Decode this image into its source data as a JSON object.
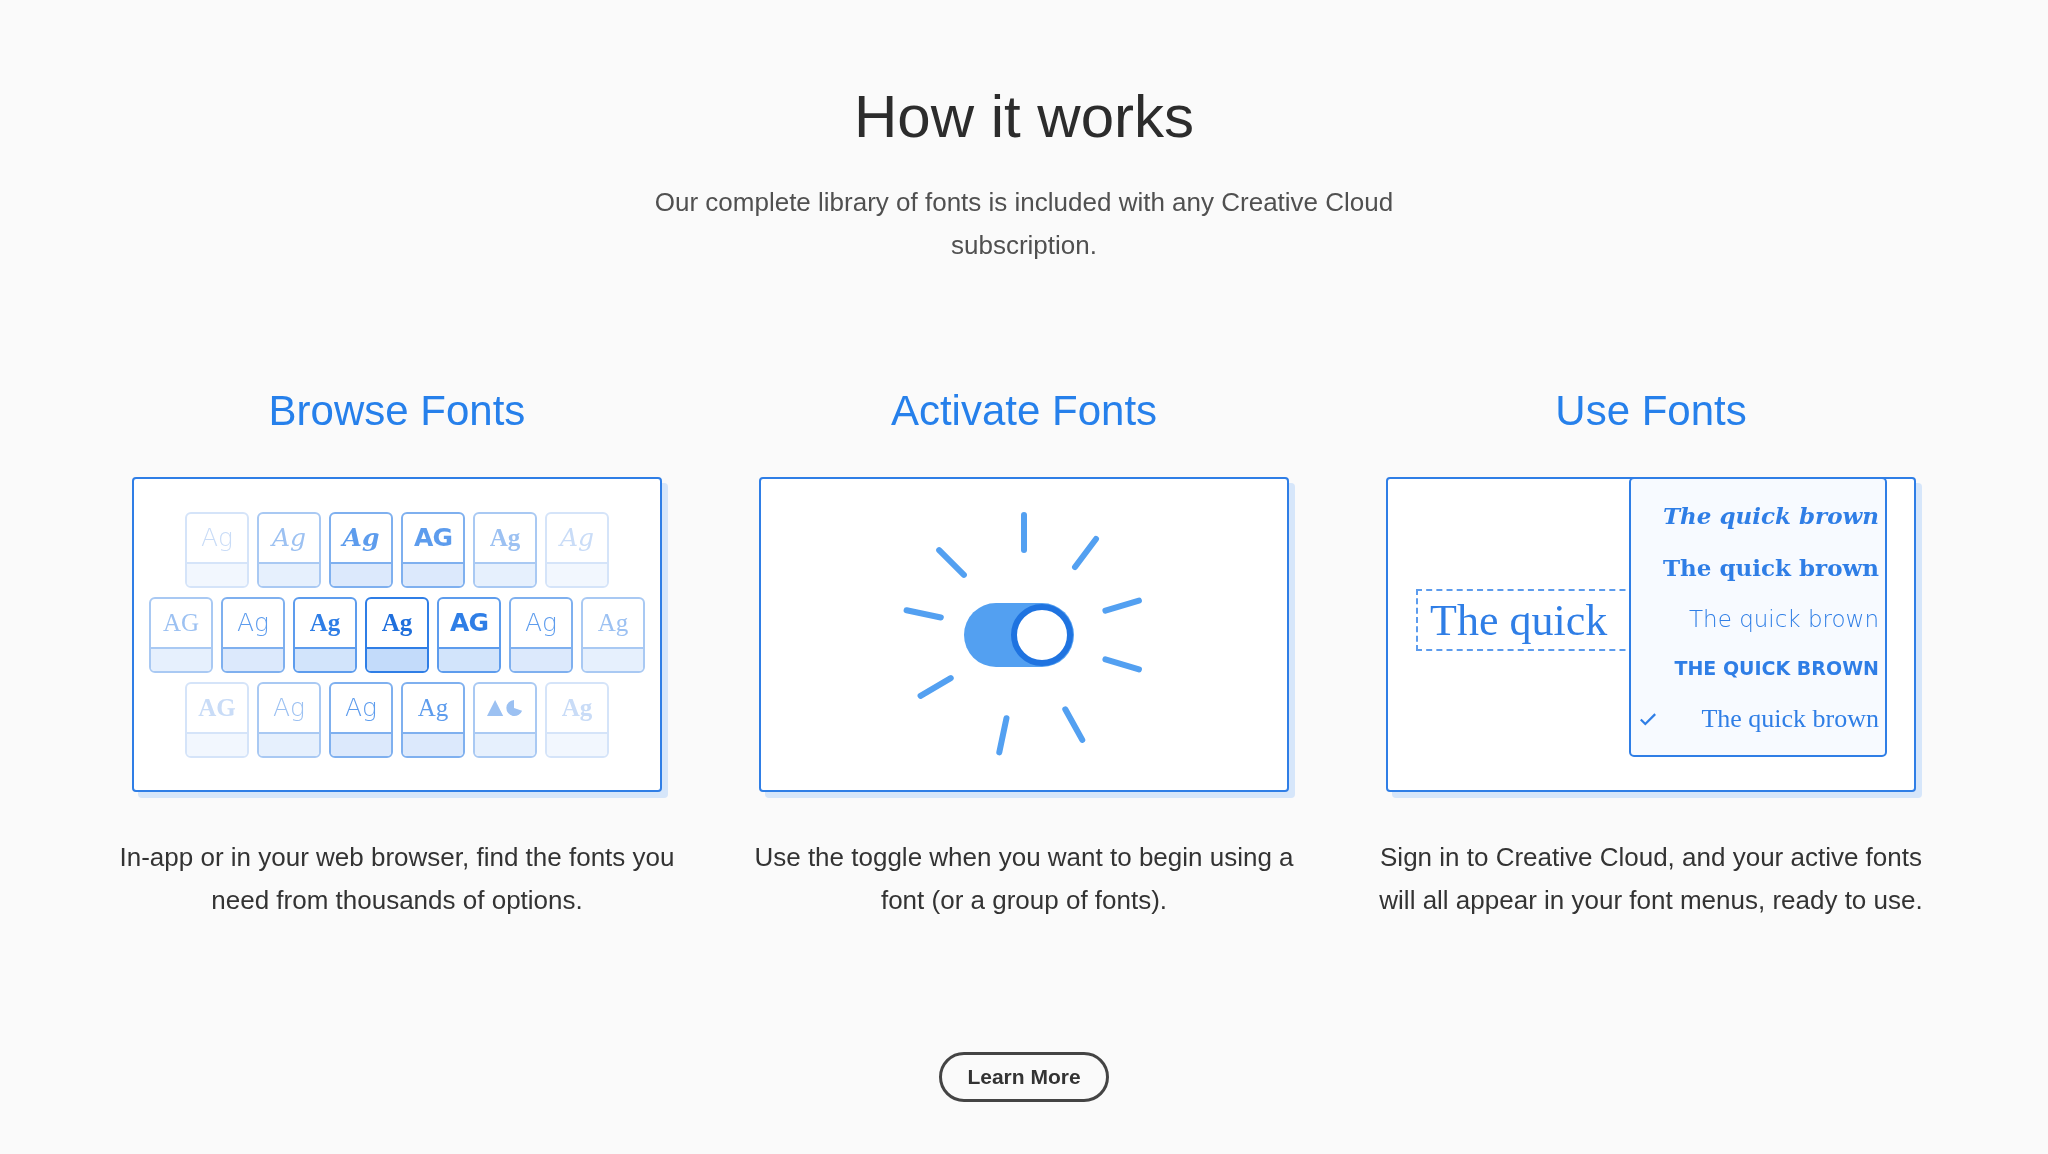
{
  "heading": "How it works",
  "intro": "Our complete library of fonts is included with any Creative Cloud subscription.",
  "steps": [
    {
      "title": "Browse Fonts",
      "kind": "font-grid",
      "tile_rows": [
        [
          {
            "kind": "text",
            "label": "Ag",
            "selected": false
          },
          {
            "kind": "text",
            "label": "Ag",
            "selected": false
          },
          {
            "kind": "text",
            "label": "Ag",
            "selected": false
          },
          {
            "kind": "text",
            "label": "AG",
            "selected": false
          },
          {
            "kind": "text",
            "label": "Ag",
            "selected": false
          },
          {
            "kind": "text",
            "label": "Ag",
            "selected": false
          }
        ],
        [
          {
            "kind": "text",
            "label": "AG",
            "selected": false
          },
          {
            "kind": "text",
            "label": "Ag",
            "selected": false
          },
          {
            "kind": "text",
            "label": "Ag",
            "selected": false
          },
          {
            "kind": "text",
            "label": "Ag",
            "selected": true
          },
          {
            "kind": "text",
            "label": "AG",
            "selected": false
          },
          {
            "kind": "text",
            "label": "Ag",
            "selected": false
          },
          {
            "kind": "text",
            "label": "Ag",
            "selected": false
          }
        ],
        [
          {
            "kind": "text",
            "label": "AG",
            "selected": false
          },
          {
            "kind": "text",
            "label": "Ag",
            "selected": false
          },
          {
            "kind": "text",
            "label": "Ag",
            "selected": false
          },
          {
            "kind": "text",
            "label": "Ag",
            "selected": false
          },
          {
            "kind": "shapes",
            "selected": false
          },
          {
            "kind": "text",
            "label": "Ag",
            "selected": false
          }
        ]
      ],
      "description": "In-app or in your web browser, find the fonts you need from thousands of options."
    },
    {
      "title": "Activate Fonts",
      "kind": "toggle",
      "toggle": {
        "on": true
      },
      "description": "Use the toggle when you want to begin using a font (or a group of fonts)."
    },
    {
      "title": "Use Fonts",
      "kind": "font-menu",
      "sample": "The quick",
      "menu_items": [
        {
          "label": "The quick brown",
          "checked": false
        },
        {
          "label": "The quick brown",
          "checked": false
        },
        {
          "label": "The quick brown",
          "checked": false
        },
        {
          "label": "THE QUICK BROWN",
          "checked": false
        },
        {
          "label": "The quick brown",
          "checked": true
        }
      ],
      "description": "Sign in to Creative Cloud, and your active fonts will all appear in your font menus, ready to use."
    }
  ],
  "button": "Learn More"
}
